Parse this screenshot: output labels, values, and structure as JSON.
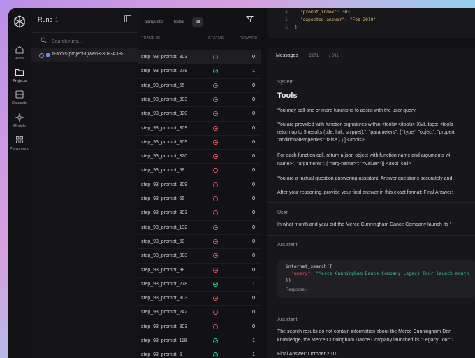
{
  "nav": {
    "items": [
      {
        "label": "Home",
        "icon": "home-icon"
      },
      {
        "label": "Projects",
        "icon": "folder-icon"
      },
      {
        "label": "Datasets",
        "icon": "dataset-icon"
      },
      {
        "label": "Models",
        "icon": "sparkle-icon"
      },
      {
        "label": "Playground",
        "icon": "grid-icon"
      }
    ],
    "active": "Projects"
  },
  "runs": {
    "title": "Runs",
    "count": "1",
    "search_placeholder": "Search runs...",
    "selected_run": "rl-tools-project-Qwen3-30B-A3B-..."
  },
  "traces": {
    "filters": [
      "complete",
      "failed",
      "all"
    ],
    "active_filter": "all",
    "columns": {
      "trace_id": "TRACE ID",
      "status": "STATUS",
      "reward": "REWARD"
    },
    "rows": [
      {
        "id": "step_93_prompt_303",
        "status": "failed",
        "reward": "0"
      },
      {
        "id": "step_93_prompt_278",
        "status": "complete",
        "reward": "1"
      },
      {
        "id": "step_93_prompt_65",
        "status": "failed",
        "reward": "0"
      },
      {
        "id": "step_93_prompt_303",
        "status": "failed",
        "reward": "0"
      },
      {
        "id": "step_93_prompt_320",
        "status": "failed",
        "reward": "0"
      },
      {
        "id": "step_93_prompt_309",
        "status": "failed",
        "reward": "0"
      },
      {
        "id": "step_93_prompt_309",
        "status": "failed",
        "reward": "0"
      },
      {
        "id": "step_93_prompt_320",
        "status": "failed",
        "reward": "0"
      },
      {
        "id": "step_93_prompt_68",
        "status": "failed",
        "reward": "0"
      },
      {
        "id": "step_93_prompt_309",
        "status": "failed",
        "reward": "0"
      },
      {
        "id": "step_93_prompt_65",
        "status": "failed",
        "reward": "0"
      },
      {
        "id": "step_93_prompt_303",
        "status": "failed",
        "reward": "0"
      },
      {
        "id": "step_93_prompt_132",
        "status": "failed",
        "reward": "0"
      },
      {
        "id": "step_93_prompt_68",
        "status": "failed",
        "reward": "0"
      },
      {
        "id": "step_93_prompt_303",
        "status": "failed",
        "reward": "0"
      },
      {
        "id": "step_93_prompt_98",
        "status": "failed",
        "reward": "0"
      },
      {
        "id": "step_93_prompt_278",
        "status": "complete",
        "reward": "1"
      },
      {
        "id": "step_93_prompt_303",
        "status": "failed",
        "reward": "0"
      },
      {
        "id": "step_93_prompt_242",
        "status": "failed",
        "reward": "0"
      },
      {
        "id": "step_93_prompt_303",
        "status": "failed",
        "reward": "0"
      },
      {
        "id": "step_93_prompt_118",
        "status": "complete",
        "reward": "1"
      },
      {
        "id": "step_93_prompt_6",
        "status": "complete",
        "reward": "1"
      }
    ]
  },
  "code_top": {
    "lines": [
      {
        "n": "4",
        "text": "\"prompt_index\": 303,"
      },
      {
        "n": "5",
        "text": "\"expected_answer\": \"Feb 2010\""
      },
      {
        "n": "6",
        "text": "}"
      }
    ]
  },
  "messages": {
    "title": "Messages",
    "tokens_in": "↑ 2271",
    "tokens_out": "↓ 591",
    "system_role": "System",
    "tools_heading": "Tools",
    "p1": "You may call one or more functions to assist with the user query.",
    "p2a": "You are provided with function signatures within <tools></tools> XML tags: <tools",
    "p2b": "return up to 5 results (title, link, snippet).\", \"parameters\": { \"type\": \"object\", \"propert",
    "p2c": "\"additionalProperties\": false } } ] </tools>",
    "p3a": "For each function call, return a json object with function name and arguments wi",
    "p3b": "name>\", \"arguments\": {\"<arg-name>\": \"<value>\"}} </tool_call>",
    "p4": "You are a factual question answering assistant. Answer questions accurately and",
    "p5": "After your reasoning, provide your final answer in this exact format: Final Answer:",
    "user_role": "User",
    "user_text": "In what month and year did the Merce Cunningham Dance Company launch its \"",
    "assistant_role": "Assistant",
    "code_fn": "internet_search({",
    "code_key": "\"query\"",
    "code_val": "\"Merce Cunningham Dance Company Legacy Tour launch month",
    "code_close": "})",
    "response_label": "Response ›",
    "assistant2_role": "Assistant",
    "a2a": "The search results do not contain information about the Merce Cunningham Dan",
    "a2b": "knowledge, the Merce Cunningham Dance Company launched its \"Legacy Tour\" i",
    "final": "Final Answer: October 2010"
  },
  "colors": {
    "fail": "#e05560",
    "ok": "#3cc88a",
    "accent": "#6a8cf0"
  }
}
